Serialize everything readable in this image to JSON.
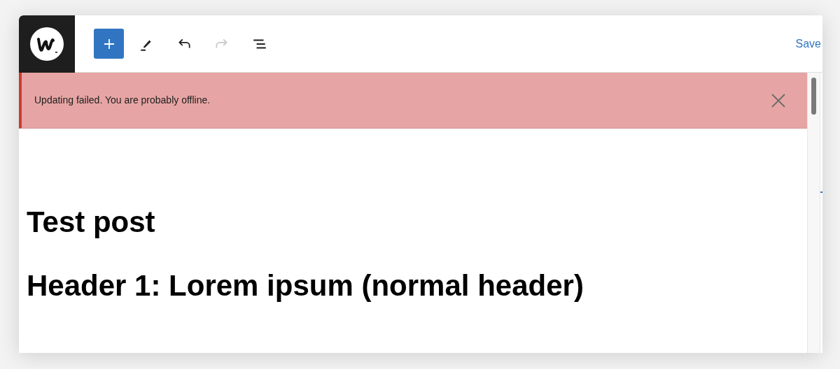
{
  "toolbar": {
    "buttons": [
      {
        "kind": "add",
        "disabled": false
      },
      {
        "kind": "edit",
        "disabled": false
      },
      {
        "kind": "undo",
        "disabled": false
      },
      {
        "kind": "redo",
        "disabled": true
      },
      {
        "kind": "list",
        "disabled": false
      }
    ],
    "save_label": "Save"
  },
  "notice": {
    "message": "Updating failed. You are probably offline."
  },
  "content": {
    "title": "Test post",
    "heading": "Header 1: Lorem ipsum (normal header)"
  }
}
